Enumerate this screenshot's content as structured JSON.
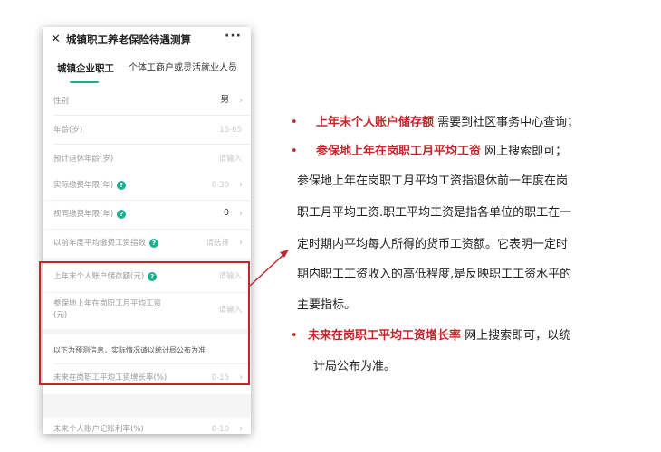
{
  "app": {
    "title": "城镇职工养老保险待遇测算",
    "tabs": [
      "城镇企业职工",
      "个体工商户或灵活就业人员"
    ]
  },
  "form": {
    "rows": [
      {
        "label": "性别",
        "value": "男"
      },
      {
        "label": "年龄(岁)",
        "value": "15-65"
      },
      {
        "label": "预计退休年龄(岁)",
        "value": "请输入"
      },
      {
        "label": "实际缴费年限(年)",
        "value": "0-30"
      },
      {
        "label": "视同缴费年限(年)",
        "value": "0"
      },
      {
        "label": "以前年度平均缴费工资指数",
        "value": "请选择"
      },
      {
        "label": "上年末个人账户储存额(元)",
        "value": "请输入"
      },
      {
        "label": "参保地上年在岗职工月平均工资",
        "label2": "(元)",
        "value": "请输入"
      },
      {
        "label": "以下为预测信息，实际情况请以统计局公布为准"
      },
      {
        "label": "未来在岗职工平均工资增长率(%)",
        "value": "0-15"
      },
      {
        "label": "未来个人账户记账利率(%)",
        "value": "0-10"
      }
    ]
  },
  "annotations": {
    "b1_red": "上年末个人账户储存额",
    "b1_rest": " 需要到社区事务中心查询；",
    "b2_red": "参保地上年在岗职工月平均工资",
    "b2_rest": " 网上搜索即可；",
    "para": [
      "参保地上年在岗职工月平均工资指退休前一年度在岗",
      "职工月平均工资.职工平均工资是指各单位的职工在一",
      "定时期内平均每人所得的货币工资额。它表明一定时",
      "期内职工工资收入的高低程度,是反映职工工资水平的",
      "主要指标。"
    ],
    "b3_red": "未来在岗职工平均工资增长率",
    "b3_rest": " 网上搜索即可，以统",
    "b3_line2": "计局公布为准。"
  }
}
